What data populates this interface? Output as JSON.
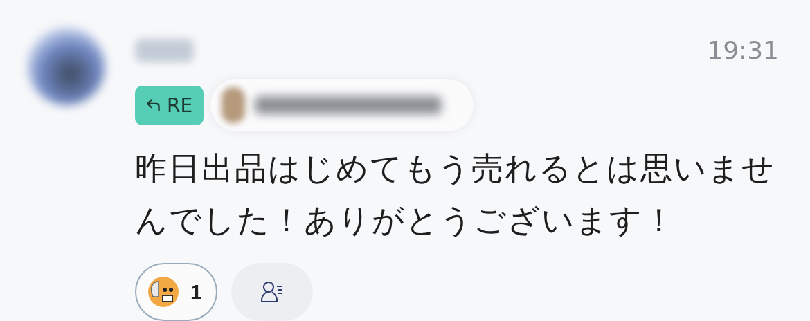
{
  "message": {
    "time": "19:31",
    "reply_badge": "RE",
    "text": "昨日出品はじめてもう売れるとは思いませんでした！ありがとうございます！"
  },
  "reactions": [
    {
      "count": "1",
      "selected": true
    }
  ]
}
